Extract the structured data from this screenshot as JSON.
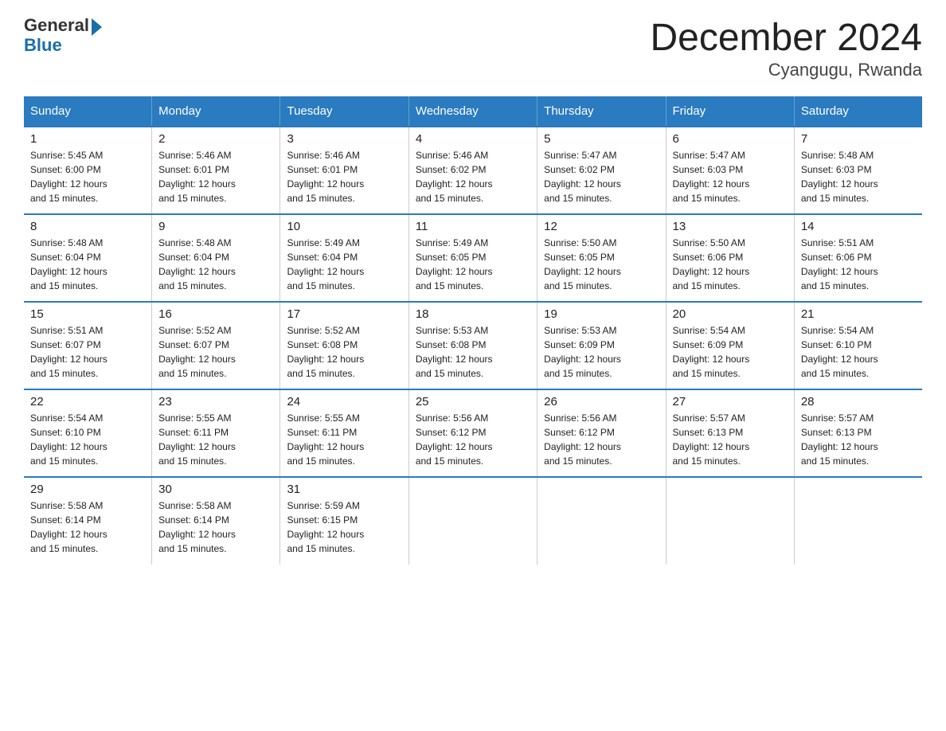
{
  "logo": {
    "general": "General",
    "blue": "Blue"
  },
  "title": "December 2024",
  "subtitle": "Cyangugu, Rwanda",
  "days_of_week": [
    "Sunday",
    "Monday",
    "Tuesday",
    "Wednesday",
    "Thursday",
    "Friday",
    "Saturday"
  ],
  "weeks": [
    [
      {
        "day": "1",
        "sunrise": "5:45 AM",
        "sunset": "6:00 PM",
        "daylight": "12 hours and 15 minutes."
      },
      {
        "day": "2",
        "sunrise": "5:46 AM",
        "sunset": "6:01 PM",
        "daylight": "12 hours and 15 minutes."
      },
      {
        "day": "3",
        "sunrise": "5:46 AM",
        "sunset": "6:01 PM",
        "daylight": "12 hours and 15 minutes."
      },
      {
        "day": "4",
        "sunrise": "5:46 AM",
        "sunset": "6:02 PM",
        "daylight": "12 hours and 15 minutes."
      },
      {
        "day": "5",
        "sunrise": "5:47 AM",
        "sunset": "6:02 PM",
        "daylight": "12 hours and 15 minutes."
      },
      {
        "day": "6",
        "sunrise": "5:47 AM",
        "sunset": "6:03 PM",
        "daylight": "12 hours and 15 minutes."
      },
      {
        "day": "7",
        "sunrise": "5:48 AM",
        "sunset": "6:03 PM",
        "daylight": "12 hours and 15 minutes."
      }
    ],
    [
      {
        "day": "8",
        "sunrise": "5:48 AM",
        "sunset": "6:04 PM",
        "daylight": "12 hours and 15 minutes."
      },
      {
        "day": "9",
        "sunrise": "5:48 AM",
        "sunset": "6:04 PM",
        "daylight": "12 hours and 15 minutes."
      },
      {
        "day": "10",
        "sunrise": "5:49 AM",
        "sunset": "6:04 PM",
        "daylight": "12 hours and 15 minutes."
      },
      {
        "day": "11",
        "sunrise": "5:49 AM",
        "sunset": "6:05 PM",
        "daylight": "12 hours and 15 minutes."
      },
      {
        "day": "12",
        "sunrise": "5:50 AM",
        "sunset": "6:05 PM",
        "daylight": "12 hours and 15 minutes."
      },
      {
        "day": "13",
        "sunrise": "5:50 AM",
        "sunset": "6:06 PM",
        "daylight": "12 hours and 15 minutes."
      },
      {
        "day": "14",
        "sunrise": "5:51 AM",
        "sunset": "6:06 PM",
        "daylight": "12 hours and 15 minutes."
      }
    ],
    [
      {
        "day": "15",
        "sunrise": "5:51 AM",
        "sunset": "6:07 PM",
        "daylight": "12 hours and 15 minutes."
      },
      {
        "day": "16",
        "sunrise": "5:52 AM",
        "sunset": "6:07 PM",
        "daylight": "12 hours and 15 minutes."
      },
      {
        "day": "17",
        "sunrise": "5:52 AM",
        "sunset": "6:08 PM",
        "daylight": "12 hours and 15 minutes."
      },
      {
        "day": "18",
        "sunrise": "5:53 AM",
        "sunset": "6:08 PM",
        "daylight": "12 hours and 15 minutes."
      },
      {
        "day": "19",
        "sunrise": "5:53 AM",
        "sunset": "6:09 PM",
        "daylight": "12 hours and 15 minutes."
      },
      {
        "day": "20",
        "sunrise": "5:54 AM",
        "sunset": "6:09 PM",
        "daylight": "12 hours and 15 minutes."
      },
      {
        "day": "21",
        "sunrise": "5:54 AM",
        "sunset": "6:10 PM",
        "daylight": "12 hours and 15 minutes."
      }
    ],
    [
      {
        "day": "22",
        "sunrise": "5:54 AM",
        "sunset": "6:10 PM",
        "daylight": "12 hours and 15 minutes."
      },
      {
        "day": "23",
        "sunrise": "5:55 AM",
        "sunset": "6:11 PM",
        "daylight": "12 hours and 15 minutes."
      },
      {
        "day": "24",
        "sunrise": "5:55 AM",
        "sunset": "6:11 PM",
        "daylight": "12 hours and 15 minutes."
      },
      {
        "day": "25",
        "sunrise": "5:56 AM",
        "sunset": "6:12 PM",
        "daylight": "12 hours and 15 minutes."
      },
      {
        "day": "26",
        "sunrise": "5:56 AM",
        "sunset": "6:12 PM",
        "daylight": "12 hours and 15 minutes."
      },
      {
        "day": "27",
        "sunrise": "5:57 AM",
        "sunset": "6:13 PM",
        "daylight": "12 hours and 15 minutes."
      },
      {
        "day": "28",
        "sunrise": "5:57 AM",
        "sunset": "6:13 PM",
        "daylight": "12 hours and 15 minutes."
      }
    ],
    [
      {
        "day": "29",
        "sunrise": "5:58 AM",
        "sunset": "6:14 PM",
        "daylight": "12 hours and 15 minutes."
      },
      {
        "day": "30",
        "sunrise": "5:58 AM",
        "sunset": "6:14 PM",
        "daylight": "12 hours and 15 minutes."
      },
      {
        "day": "31",
        "sunrise": "5:59 AM",
        "sunset": "6:15 PM",
        "daylight": "12 hours and 15 minutes."
      },
      null,
      null,
      null,
      null
    ]
  ],
  "labels": {
    "sunrise": "Sunrise:",
    "sunset": "Sunset:",
    "daylight": "Daylight: 12 hours"
  }
}
